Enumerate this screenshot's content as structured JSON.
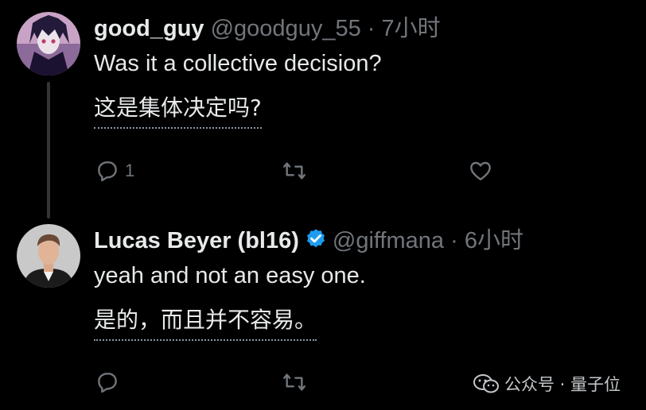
{
  "tweets": [
    {
      "name": "good_guy",
      "handle": "@goodguy_55",
      "separator": "·",
      "time": "7小时",
      "text": "Was it a collective decision?",
      "translation": "这是集体决定吗?",
      "reply_count": "1",
      "icons": [
        "reply-icon",
        "retweet-icon",
        "like-icon"
      ]
    },
    {
      "name": "Lucas Beyer (bl16)",
      "verified": true,
      "handle": "@giffmana",
      "separator": "·",
      "time": "6小时",
      "text": "yeah and not an easy one.",
      "translation": "是的，而且并不容易。",
      "reply_count": "",
      "icons": [
        "reply-icon",
        "retweet-icon"
      ]
    }
  ],
  "watermark": {
    "text": "公众号 · 量子位",
    "icon": "wechat-icon"
  },
  "colors": {
    "background": "#000000",
    "text": "#e7e9ea",
    "muted": "#71767b",
    "verified": "#1d9bf0"
  }
}
